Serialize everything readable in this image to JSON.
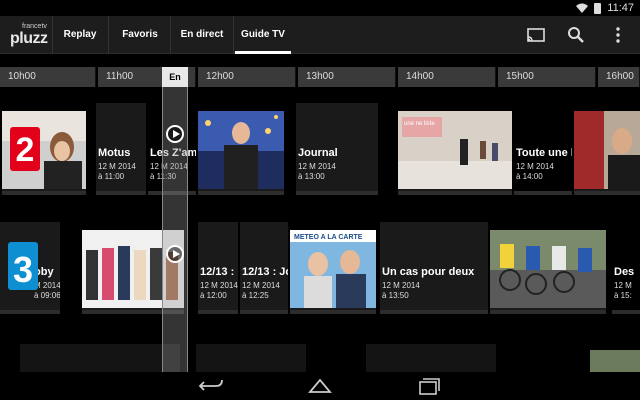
{
  "status": {
    "time": "11:47"
  },
  "app": {
    "logo_small": "francetv",
    "logo_big": "pluzz",
    "tabs": [
      {
        "label": "Replay"
      },
      {
        "label": "Favoris"
      },
      {
        "label": "En direct"
      },
      {
        "label": "Guide TV",
        "active": true
      }
    ],
    "actions": [
      "cast-icon",
      "search-icon",
      "overflow-menu-icon"
    ]
  },
  "timeline": {
    "slots": [
      "10h00",
      "11h00",
      "12h00",
      "13h00",
      "14h00",
      "15h00",
      "16h00"
    ],
    "now_label": "En"
  },
  "rows": [
    {
      "channel": "2",
      "channel_color": "#e2001a",
      "programs": [
        {
          "title": "",
          "date": "",
          "time": ""
        },
        {
          "title": "Motus",
          "date": "12 M 2014",
          "time": "à 11:00"
        },
        {
          "title": "Les Z'amo",
          "date": "12 M 2014",
          "time": "à 11:30"
        },
        {
          "title": "",
          "date": "",
          "time": ""
        },
        {
          "title": "Journal",
          "date": "12 M 2014",
          "time": "à 13:00"
        },
        {
          "title": "",
          "date": "",
          "time": ""
        },
        {
          "title": "Toute une h",
          "date": "12 M 2014",
          "time": "à 14:00"
        },
        {
          "title": "",
          "date": "",
          "time": ""
        }
      ]
    },
    {
      "channel": "3",
      "channel_color": "#0d8fd1",
      "programs": [
        {
          "title": "oby",
          "date": "M 2014",
          "time": "à 09:06"
        },
        {
          "title": "",
          "date": "",
          "time": ""
        },
        {
          "title": "12/13 :",
          "date": "12 M 2014",
          "time": "à 12:00"
        },
        {
          "title": "12/13 : Jo",
          "date": "12 M 2014",
          "time": "à 12:25"
        },
        {
          "title": "",
          "date": "",
          "time": ""
        },
        {
          "title": "Un cas pour deux",
          "date": "12 M 2014",
          "time": "à 13:50"
        },
        {
          "title": "",
          "date": "",
          "time": ""
        },
        {
          "title": "Des",
          "date": "12 M",
          "time": "à 15:"
        }
      ]
    }
  ],
  "thumb_texts": {
    "liste": "une ne liste",
    "meteo": "METEO A LA CARTE"
  },
  "nav": [
    "back-icon",
    "home-icon",
    "recents-icon"
  ]
}
